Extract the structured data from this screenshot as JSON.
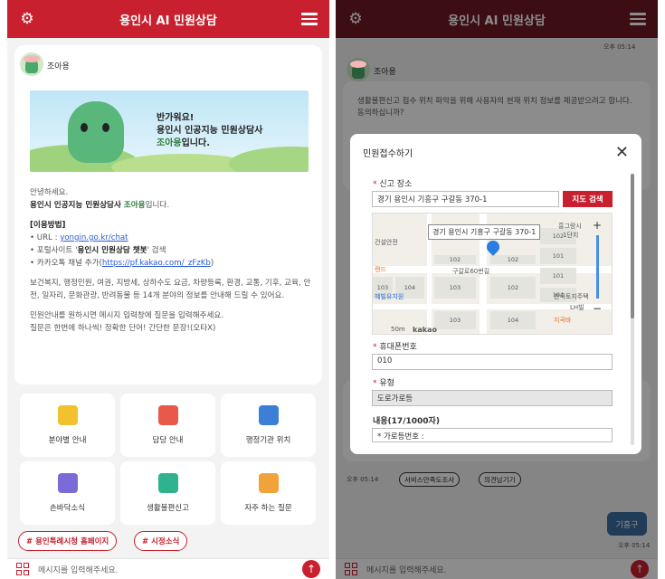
{
  "colors": {
    "brand": "#c8202e",
    "brand_dim": "#6e1a23",
    "accent_green": "#2d7a3a",
    "link": "#2a5bd7"
  },
  "app": {
    "title": "용인시 AI 민원상담"
  },
  "bot": {
    "name": "조아용"
  },
  "banner": {
    "line1": "반가워요!",
    "line2": "용인시 인공지능 민원상담사",
    "line3_name": "조아용",
    "line3_rest": "입니다."
  },
  "intro": {
    "greeting": "안녕하세요.",
    "self_prefix": "용인시 인공지능 민원상담사 ",
    "self_name": "조아용",
    "self_suffix": "입니다.",
    "usage_title": "[이용방법]",
    "url_prefix": "• URL : ",
    "url": "yongin.go.kr/chat",
    "portal_prefix": "• 포털사이트 '",
    "portal_name": "용인시 민원상담 챗봇",
    "portal_suffix": "' 검색",
    "kakao_prefix": "• 카카오톡 채널 추가(",
    "kakao_url": "https://pf.kakao.com/_zFzKb",
    "kakao_suffix": ")",
    "fields": "보건복지, 행정민원, 여권, 지방세, 상하수도 요금, 차량등록, 환경, 교통, 기후, 교육, 안전, 일자리, 문화관광, 반려동물 등 14개 분야의 정보를 안내해 드릴 수 있어요.",
    "guide1": "민원안내를 원하시면 메시지 입력창에 질문을 입력해주세요.",
    "guide2": "질문은 한번에 하나씩! 정확한 단어! 간단한 문장!(오타X)"
  },
  "tiles": [
    {
      "label": "분야별 안내",
      "icon": "clipboard-icon",
      "color": "#f2c12e"
    },
    {
      "label": "담당 안내",
      "icon": "person-card-icon",
      "color": "#e8594b"
    },
    {
      "label": "행정기관 위치",
      "icon": "map-pin-icon",
      "color": "#3d7fd6"
    },
    {
      "label": "손바닥소식",
      "icon": "megaphone-icon",
      "color": "#7a6bd6"
    },
    {
      "label": "생활불편신고",
      "icon": "report-icon",
      "color": "#2fb28e"
    },
    {
      "label": "자주 하는 질문",
      "icon": "pencil-note-icon",
      "color": "#f0a33a"
    }
  ],
  "chips": [
    "# 용인특례시청 홈페이지",
    "# 시정소식"
  ],
  "footer": {
    "placeholder": "메시지를 입력해주세요."
  },
  "right": {
    "time_top": "오후 05:14",
    "bot_name": "조아용",
    "msg1": "생활불편신고 접수 위치 파악을 위해 사용자의 현재 위치 정보를 제공받으려고 합니다.",
    "msg2": "동의하십니까?",
    "time_bottom": "오후 05:14",
    "chip1": "서비스만족도조사",
    "chip2": "의견남기기",
    "user_msg": "기흥구",
    "user_time": "오후 05:14"
  },
  "modal": {
    "title": "민원접수하기",
    "location_label": "신고 장소",
    "location_value": "경기 용인시 기흥구 구갈동 370-1",
    "map_search": "지도 검색",
    "map_tooltip": "경기 용인시 기흥구 구갈동 370-1",
    "map_labels": {
      "l1": "건설안전",
      "l2": "구갈로60번길",
      "l3": "한국토지주택",
      "l4": "LH빌",
      "l5": "지곡바",
      "l6": "흥그랑시",
      "l7": "1단지",
      "l8": "랜드",
      "l9": "혜빌유치원"
    },
    "map_blocks": [
      "104",
      "103",
      "102",
      "101",
      "103",
      "104",
      "101",
      "102",
      "102",
      "104",
      "103",
      "102"
    ],
    "map_scale": "50m",
    "map_brand": "kakao",
    "phone_label": "휴대폰번호",
    "phone_value": "010",
    "type_label": "유형",
    "type_value": "도로가로등",
    "content_label": "내용(17/1000자)",
    "content_value": "* 가로등번호 :"
  }
}
